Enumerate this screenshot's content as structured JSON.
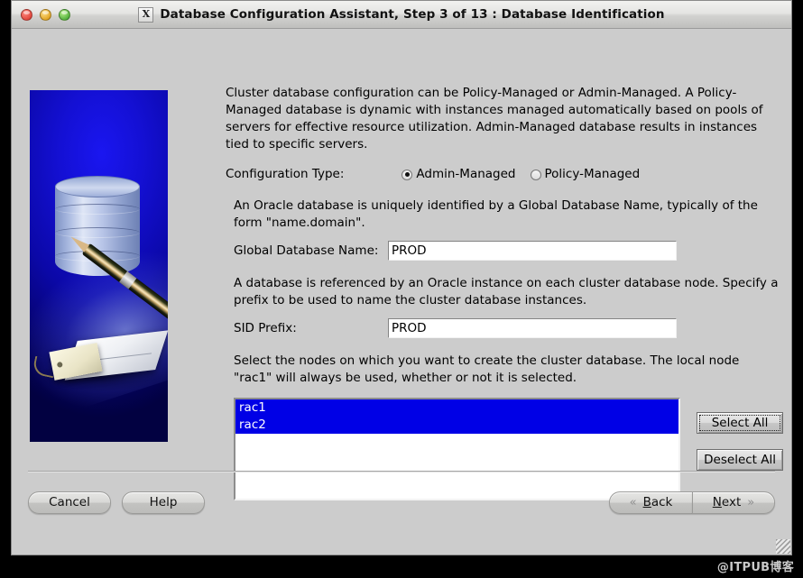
{
  "titlebar": {
    "icon": "x-window-icon",
    "title": "Database Configuration Assistant, Step 3 of 13 : Database Identification",
    "buttons": {
      "close": "close",
      "minimize": "minimize",
      "zoom": "zoom"
    }
  },
  "main": {
    "intro_text": "Cluster database configuration can be Policy-Managed or Admin-Managed. A Policy-Managed database is dynamic with instances managed automatically based on pools of servers for effective resource utilization. Admin-Managed database results in instances tied to specific servers.",
    "config_type": {
      "label": "Configuration Type:",
      "options": [
        {
          "label": "Admin-Managed",
          "selected": true
        },
        {
          "label": "Policy-Managed",
          "selected": false
        }
      ]
    },
    "global_db": {
      "help_text": "An Oracle database is uniquely identified by a Global Database Name, typically of the form \"name.domain\".",
      "label": "Global Database Name:",
      "value": "PROD",
      "placeholder": ""
    },
    "sid": {
      "help_text": "A database is referenced by an Oracle instance on each cluster database node. Specify a prefix to be used to name the cluster database instances.",
      "label": "SID Prefix:",
      "value": "PROD",
      "placeholder": ""
    },
    "nodes": {
      "help_text": "Select the nodes on which you want to create the cluster database. The local node \"rac1\" will always be used, whether or not it is selected.",
      "items": [
        {
          "label": "rac1",
          "selected": true
        },
        {
          "label": "rac2",
          "selected": true
        }
      ],
      "select_all_label": "Select All",
      "deselect_all_label": "Deselect All"
    }
  },
  "footer": {
    "cancel_label": "Cancel",
    "help_label": "Help",
    "back_label": "Back",
    "back_mnemonic": "B",
    "next_label": "Next",
    "next_mnemonic": "N",
    "back_chevron": "«",
    "next_chevron": "»"
  },
  "watermark": {
    "text": "@ITPUB博客"
  },
  "colors": {
    "dialog_bg": "#cccccc",
    "selection_blue": "#0000e6",
    "panel_blue": "#1410d4",
    "text": "#000000"
  }
}
